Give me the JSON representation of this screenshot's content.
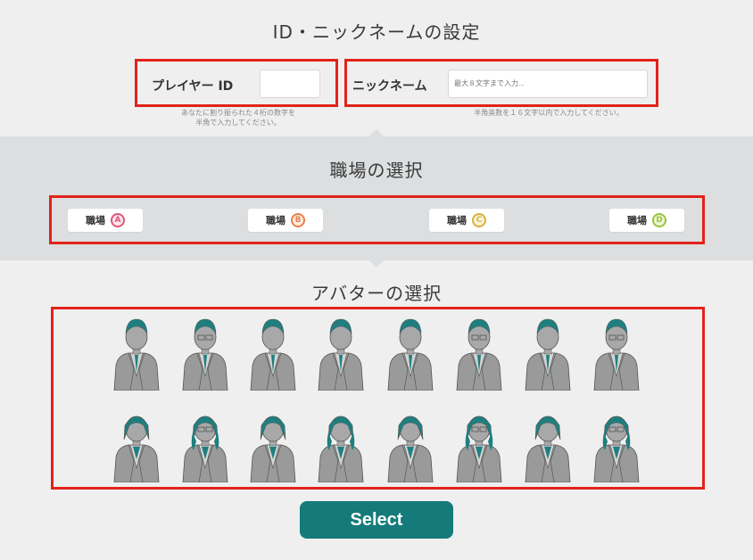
{
  "id_section": {
    "title": "ID・ニックネームの設定",
    "player_id_label": "プレイヤー ID",
    "player_id_value": "",
    "player_id_hint_1": "あなたに割り振られた４桁の数字を",
    "player_id_hint_2": "半角で入力してください。",
    "nickname_label": "ニックネーム",
    "nickname_placeholder": "最大８文字まで入力...",
    "nickname_hint": "半角英数を１６文字以内で入力してください。"
  },
  "workplace_section": {
    "title": "職場の選択",
    "options": [
      {
        "label": "職場",
        "badge": "A",
        "color": "#e0577a"
      },
      {
        "label": "職場",
        "badge": "B",
        "color": "#e8824a"
      },
      {
        "label": "職場",
        "badge": "C",
        "color": "#d8b23a"
      },
      {
        "label": "職場",
        "badge": "D",
        "color": "#9cc23a"
      }
    ]
  },
  "avatar_section": {
    "title": "アバターの選択",
    "rows": [
      [
        "male-1",
        "male-2",
        "male-3",
        "male-4",
        "male-5",
        "male-6",
        "male-7",
        "male-8"
      ],
      [
        "female-1",
        "female-2",
        "female-3",
        "female-4",
        "female-5",
        "female-6",
        "female-7",
        "female-8"
      ]
    ]
  },
  "footer": {
    "select_label": "Select",
    "accent_color": "#157a7a",
    "highlight_color": "#e2231a"
  }
}
